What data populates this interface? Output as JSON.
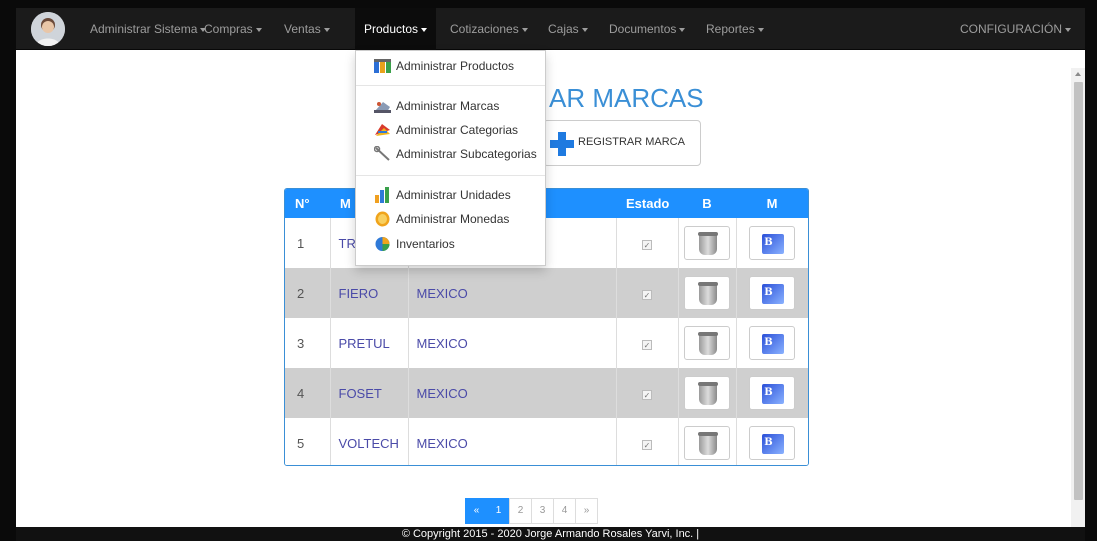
{
  "navbar": {
    "items": [
      {
        "label": "Administrar Sistema"
      },
      {
        "label": "Compras"
      },
      {
        "label": "Ventas"
      },
      {
        "label": "Productos"
      },
      {
        "label": "Cotizaciones"
      },
      {
        "label": "Cajas"
      },
      {
        "label": "Documentos"
      },
      {
        "label": "Reportes"
      }
    ],
    "right": "CONFIGURACIÓN"
  },
  "dropdown": {
    "items": [
      {
        "label": "Administrar Productos",
        "icon": "products-icon"
      },
      {
        "label": "Administrar Marcas",
        "icon": "brands-icon"
      },
      {
        "label": "Administrar Categorias",
        "icon": "categories-icon"
      },
      {
        "label": "Administrar Subcategorias",
        "icon": "subcategories-icon"
      },
      {
        "label": "Administrar Unidades",
        "icon": "units-icon"
      },
      {
        "label": "Administrar Monedas",
        "icon": "coins-icon"
      },
      {
        "label": "Inventarios",
        "icon": "inventory-icon"
      }
    ]
  },
  "page": {
    "title": "AR MARCAS",
    "register_button": "REGISTRAR MARCA"
  },
  "table": {
    "headers": [
      "N°",
      "M",
      "",
      "Estado",
      "B",
      "M"
    ],
    "rows": [
      {
        "num": "1",
        "name": "TR",
        "country": ""
      },
      {
        "num": "2",
        "name": "FIERO",
        "country": "MEXICO"
      },
      {
        "num": "3",
        "name": "PRETUL",
        "country": "MEXICO"
      },
      {
        "num": "4",
        "name": "FOSET",
        "country": "MEXICO"
      },
      {
        "num": "5",
        "name": "VOLTECH",
        "country": "MEXICO"
      }
    ]
  },
  "pagination": {
    "prev": "«",
    "pages": [
      "1",
      "2",
      "3",
      "4"
    ],
    "next": "»"
  },
  "footer": "© Copyright 2015 - 2020 Jorge Armando Rosales Yarvi, Inc. |"
}
